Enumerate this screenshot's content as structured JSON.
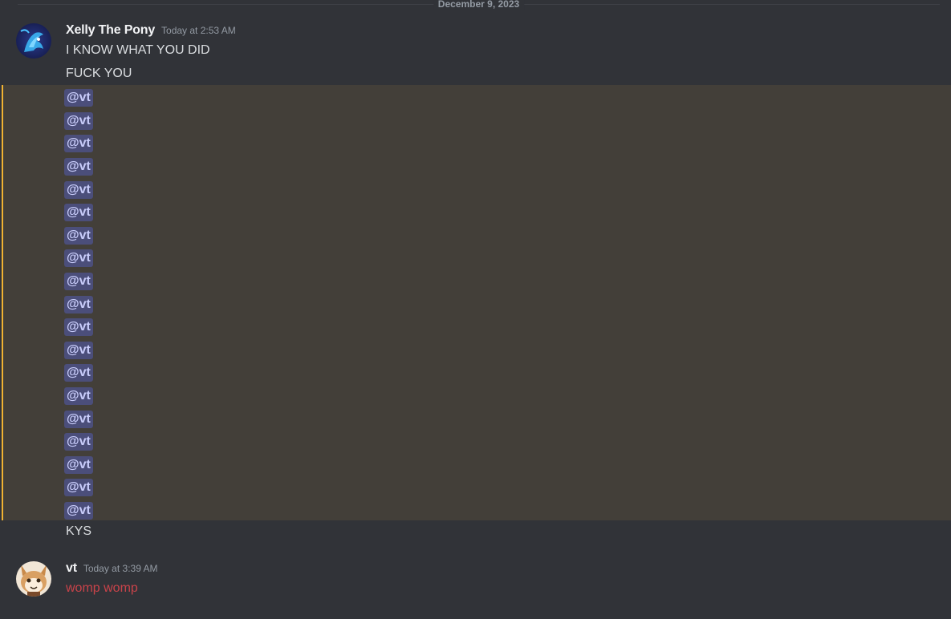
{
  "date_divider": "December 9, 2023",
  "messages": [
    {
      "username": "Xelly The Pony",
      "timestamp": "Today at 2:53 AM",
      "lines": [
        "I KNOW WHAT YOU DID",
        "FUCK YOU"
      ],
      "mentions": [
        "@vt",
        "@vt",
        "@vt",
        "@vt",
        "@vt",
        "@vt",
        "@vt",
        "@vt",
        "@vt",
        "@vt",
        "@vt",
        "@vt",
        "@vt",
        "@vt",
        "@vt",
        "@vt",
        "@vt",
        "@vt",
        "@vt"
      ],
      "trailing_line": "KYS"
    },
    {
      "username": "vt",
      "timestamp": "Today at 3:39 AM",
      "lines": [
        "womp womp"
      ]
    }
  ],
  "colors": {
    "background": "#313338",
    "mention_highlight_bg": "#433f39",
    "mention_highlight_border": "#f0b232",
    "mention_pill_bg": "#4b4e7a",
    "mention_text": "#c9cdfb",
    "red_text": "#c9434a"
  },
  "icons": {
    "avatar_1": "pony-avatar-icon",
    "avatar_2": "cat-avatar-icon"
  }
}
